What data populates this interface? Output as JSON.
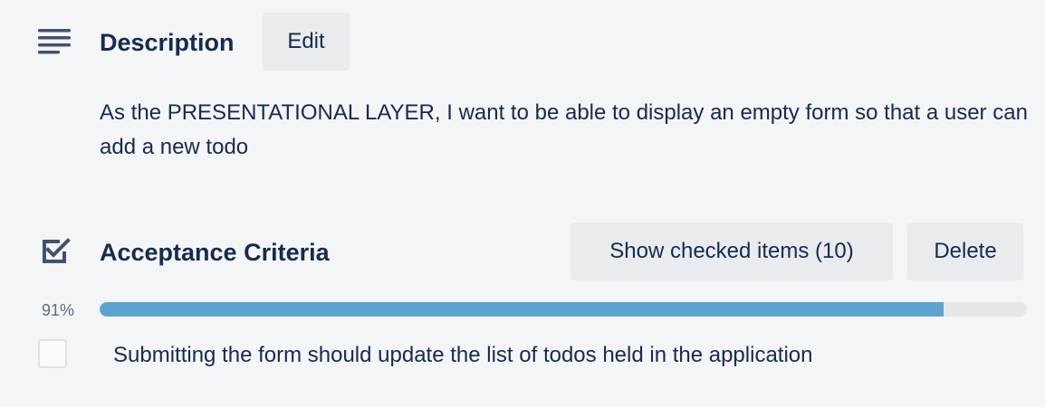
{
  "description": {
    "title": "Description",
    "edit_label": "Edit",
    "text": "As the PRESENTATIONAL LAYER, I want to be able to display an empty form so that a user can add a new todo"
  },
  "checklist": {
    "title": "Acceptance Criteria",
    "show_checked_label": "Show checked items (10)",
    "delete_label": "Delete",
    "progress_label": "91%",
    "progress_value": 0.91,
    "items": [
      {
        "text": "Submitting the form should update the list of todos held in the application",
        "checked": false
      }
    ]
  },
  "icons": {
    "description": "description-lines-icon",
    "checklist": "checkbox-checked-icon"
  },
  "colors": {
    "background": "#f4f5f7",
    "text": "#172b4d",
    "button_bg": "#e9ebee",
    "progress_fill": "#5ba4cf",
    "progress_track": "#e5e7eb"
  }
}
